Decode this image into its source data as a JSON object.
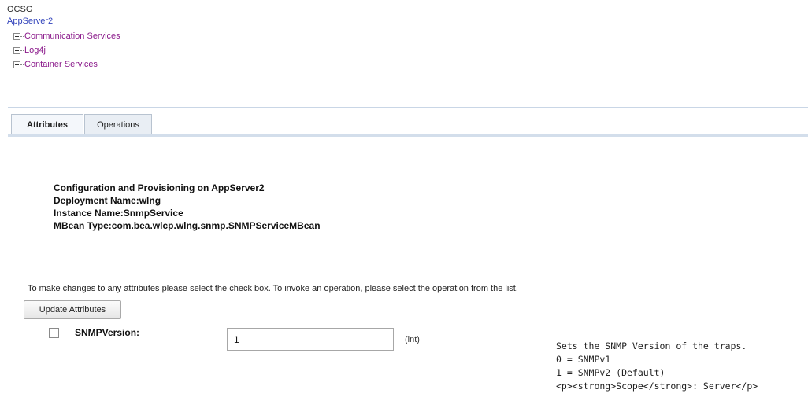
{
  "tree": {
    "root": "OCSG",
    "server": "AppServer2",
    "nodes": [
      {
        "label": "Communication Services"
      },
      {
        "label": "Log4j"
      },
      {
        "label": "Container Services"
      }
    ]
  },
  "tabs": [
    {
      "label": "Attributes",
      "active": true
    },
    {
      "label": "Operations",
      "active": false
    }
  ],
  "info": {
    "title": "Configuration and Provisioning on AppServer2",
    "deployment": "Deployment Name:wlng",
    "instance": "Instance Name:SnmpService",
    "mbean_type": "MBean Type:com.bea.wlcp.wlng.snmp.SNMPServiceMBean"
  },
  "instructions": "To make changes to any attributes please select the check box. To invoke an operation, please select the operation from the list.",
  "update_button_label": "Update Attributes",
  "attributes": [
    {
      "name": "SNMPVersion:",
      "value": "1",
      "type": "(int)",
      "checked": false,
      "description": [
        "Sets the SNMP Version of the traps.",
        "0 = SNMPv1",
        "1 = SNMPv2 (Default)",
        "<p><strong>Scope</strong>: Server</p>"
      ]
    }
  ],
  "colors": {
    "link": "#3344bb",
    "tree_label": "#8b1a8b",
    "tab_border": "#b8c3d0"
  }
}
